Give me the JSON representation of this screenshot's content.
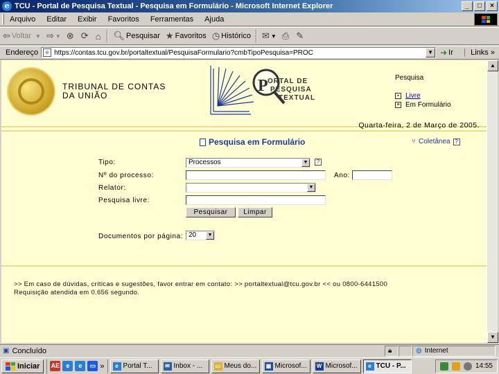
{
  "window": {
    "title": "TCU - Portal de Pesquisa Textual - Pesquisa em Formulário - Microsoft Internet Explorer"
  },
  "menu": [
    "Arquivo",
    "Editar",
    "Exibir",
    "Favoritos",
    "Ferramentas",
    "Ajuda"
  ],
  "toolbar": {
    "back": "Voltar",
    "search": "Pesquisar",
    "favorites": "Favoritos",
    "history": "Histórico"
  },
  "address": {
    "label": "Endereço",
    "url": "https://contas.tcu.gov.br/portaltextual/PesquisaFormulario?cmbTipoPesquisa=PROC",
    "go": "Ir",
    "links": "Links"
  },
  "page": {
    "org_line1": "TRIBUNAL DE CONTAS",
    "org_line2": "DA UNIÃO",
    "portal_line1": "ORTAL DE",
    "portal_line2": "PESQUISA",
    "portal_line3": "TEXTUAL",
    "portal_initial": "P",
    "side_heading": "Pesquisa",
    "side_link1": "Livre",
    "side_link2": "Em Formulário",
    "date": "Quarta-feira, 2 de Março de 2005.",
    "form_title": "Pesquisa em Formulário",
    "coletanea": "Coletânea",
    "help_mark": "?",
    "form": {
      "tipo_label": "Tipo:",
      "tipo_value": "Processos",
      "processo_label": "Nº do processo:",
      "ano_label": "Ano:",
      "relator_label": "Relator:",
      "livre_label": "Pesquisa livre:",
      "search_button": "Pesquisar",
      "clear_button": "Limpar",
      "docs_label": "Documentos por página:",
      "docs_value": "20"
    },
    "footer_line1": ">> Em caso de dúvidas, críticas e sugestões, favor entrar em contato: >> portaltextual@tcu.gov.br << ou 0800-6441500",
    "footer_line2": "Requisição atendida em 0.656 segundo."
  },
  "status": {
    "text": "Concluído",
    "zone": "Internet"
  },
  "taskbar": {
    "start": "Iniciar",
    "tasks": [
      "Portal T...",
      "Inbox - ...",
      "Meus do...",
      "Microsof...",
      "Microsof...",
      "TCU - P..."
    ],
    "clock": "14:55"
  },
  "colors": {
    "page_bg": "#fffdd2",
    "title_blue": "#1a3a9a",
    "titlebar": "#0a246a"
  }
}
